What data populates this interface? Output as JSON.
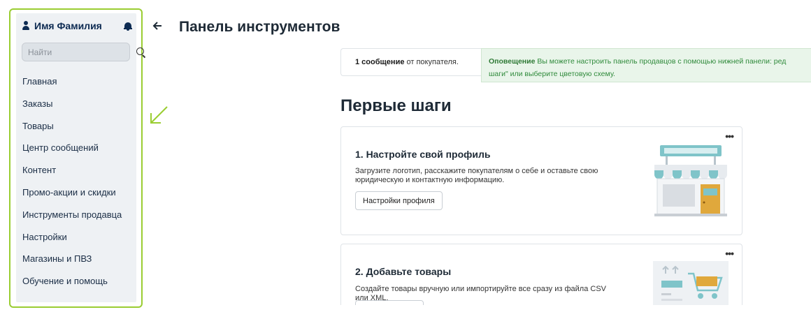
{
  "user": {
    "name": "Имя Фамилия"
  },
  "search": {
    "placeholder": "Найти"
  },
  "nav": {
    "items": [
      {
        "label": "Главная"
      },
      {
        "label": "Заказы"
      },
      {
        "label": "Товары"
      },
      {
        "label": "Центр сообщений"
      },
      {
        "label": "Контент"
      },
      {
        "label": "Промо-акции и скидки"
      },
      {
        "label": "Инструменты продавца"
      },
      {
        "label": "Настройки"
      },
      {
        "label": "Магазины и ПВЗ"
      },
      {
        "label": "Обучение и помощь"
      }
    ]
  },
  "header": {
    "title": "Панель инструментов"
  },
  "message": {
    "count": "1 сообщение",
    "rest": " от покупателя."
  },
  "alert": {
    "label": "Оповещение",
    "line1": " Вы можете настроить панель продавцов с помощью нижней панели: ред",
    "line2": "шаги\" или выберите цветовую схему."
  },
  "section": {
    "title": "Первые шаги"
  },
  "cards": [
    {
      "title": "1. Настройте свой профиль",
      "description": "Загрузите логотип, расскажите покупателям о себе и оставьте свою юридическую и контактную информацию.",
      "button": "Настройки профиля",
      "menu": "•••",
      "illustration": "storefront-icon"
    },
    {
      "title": "2. Добавьте товары",
      "description": "Создайте товары вручную или импортируйте все сразу из файла CSV или XML.",
      "button": "",
      "menu": "•••",
      "illustration": "shopping-cart-icon"
    }
  ],
  "colors": {
    "highlight_border": "#9acd32",
    "sidebar_bg": "#eef1f4",
    "accent_dark": "#0d2b52",
    "alert_bg": "#e9f5ea",
    "alert_text": "#2f8a3b",
    "illustration_teal": "#7fc4c9",
    "illustration_orange": "#e0a83c"
  }
}
